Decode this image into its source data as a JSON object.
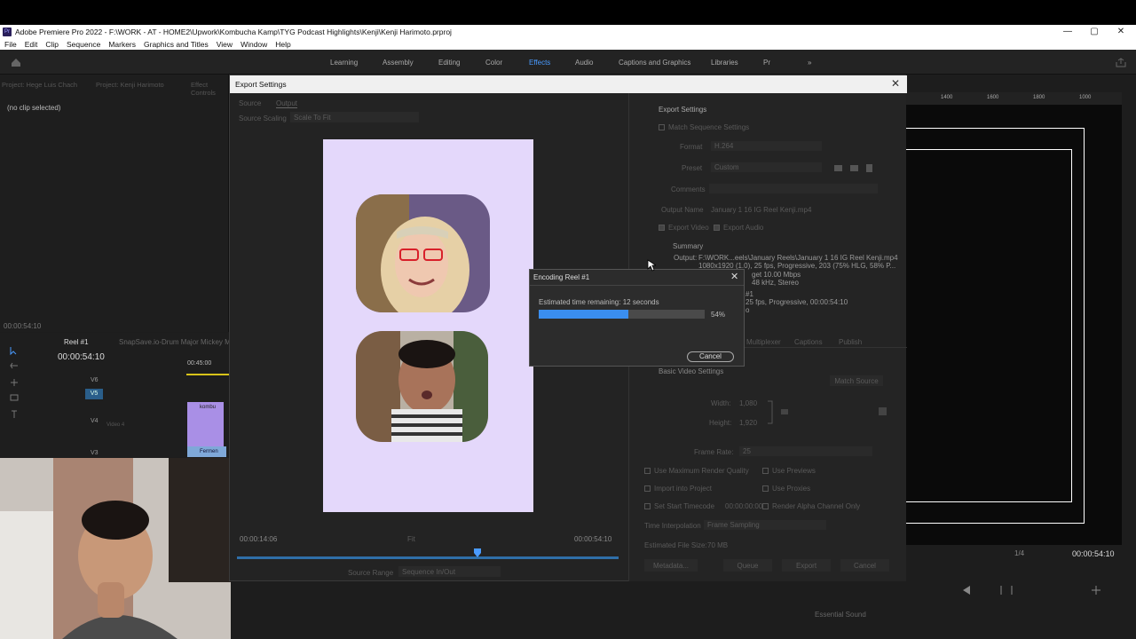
{
  "window": {
    "title": "Adobe Premiere Pro 2022 - F:\\WORK - AT - HOME2\\Upwork\\Kombucha Kamp\\TYG Podcast Highlights\\Kenji\\Kenji Harimoto.prproj",
    "app_icon": "Pr",
    "minimize": "—",
    "maximize": "▢",
    "close": "✕"
  },
  "menu": [
    "File",
    "Edit",
    "Clip",
    "Sequence",
    "Markers",
    "Graphics and Titles",
    "View",
    "Window",
    "Help"
  ],
  "workspaces": {
    "items": [
      "Learning",
      "Assembly",
      "Editing",
      "Color",
      "Effects",
      "Audio",
      "Captions and Graphics",
      "Libraries",
      "Pr"
    ],
    "active": "Effects",
    "more": "»"
  },
  "left_panel": {
    "tabs": [
      "Project: Hege Luis Chach",
      "Project: Kenji Harimoto",
      "Effect Controls"
    ],
    "no_clip": "(no clip selected)",
    "timecode_bottom": "00:00:54:10"
  },
  "timeline": {
    "tab": "Reel #1",
    "tab2": "SnapSave.io-Drum Major Mickey Mo",
    "timecode": "00:00:54:10",
    "ruler_time": "00:45:00",
    "tracks": [
      {
        "name": "V6"
      },
      {
        "name": "V5"
      },
      {
        "name": "V4",
        "sub": "Video 4"
      },
      {
        "name": "V3"
      }
    ],
    "clips": [
      "kombu",
      "Fermen"
    ]
  },
  "right_panel": {
    "ruler_ticks": [
      "1400",
      "1600",
      "1800",
      "1000"
    ],
    "timecode": "00:00:54:10",
    "zoom": "1/4",
    "essential_sound": "Essential Sound"
  },
  "export_dialog": {
    "title": "Export Settings",
    "tabs": [
      "Source",
      "Output"
    ],
    "source_scaling_label": "Source Scaling",
    "source_scaling_value": "Scale To Fit",
    "timecode_left": "00:00:14:06",
    "timecode_right": "00:00:54:10",
    "fit": "Fit",
    "source_range_label": "Source Range",
    "source_range_value": "Sequence In/Out",
    "settings": {
      "heading": "Export Settings",
      "match_sequence": "Match Sequence Settings",
      "format_label": "Format",
      "format_value": "H.264",
      "preset_label": "Preset",
      "preset_value": "Custom",
      "comments_label": "Comments",
      "output_name_label": "Output Name",
      "output_name_value": "January 1 16 IG Reel Kenji.mp4",
      "export_video": "Export Video",
      "export_audio": "Export Audio",
      "summary_heading": "Summary",
      "output_label": "Output:",
      "output_lines": [
        "F:\\WORK...eels\\January Reels\\January 1 16 IG Reel Kenji.mp4",
        "1080x1920 (1.0), 25 fps, Progressive, 203 (75% HLG, 58% P...",
        "get 10.00 Mbps",
        "48 kHz, Stereo"
      ],
      "source_lines": [
        "#1",
        "25 fps, Progressive, 00:00:54:10",
        "o"
      ]
    },
    "lower_tabs": [
      "Multiplexer",
      "Captions",
      "Publish"
    ],
    "video_settings": {
      "heading": "Basic Video Settings",
      "match_source": "Match Source",
      "width_label": "Width:",
      "width_value": "1,080",
      "height_label": "Height:",
      "height_value": "1,920",
      "frame_rate_label": "Frame Rate:",
      "frame_rate_value": "25"
    },
    "options": {
      "max_render": "Use Maximum Render Quality",
      "use_previews": "Use Previews",
      "import_project": "Import into Project",
      "use_proxies": "Use Proxies",
      "start_timecode": "Set Start Timecode",
      "start_timecode_value": "00:00:00:00",
      "render_alpha": "Render Alpha Channel Only",
      "time_interp_label": "Time Interpolation",
      "time_interp_value": "Frame Sampling",
      "file_size": "Estimated File Size:",
      "file_size_value": "70 MB"
    },
    "buttons": [
      "Metadata...",
      "Queue",
      "Export",
      "Cancel"
    ]
  },
  "encoding": {
    "title": "Encoding Reel #1",
    "remaining": "Estimated time remaining: 12 seconds",
    "percent_text": "54%",
    "progress": 0.54,
    "cancel": "Cancel"
  },
  "colors": {
    "accent": "#3a8ef0",
    "preview_bg": "#e4d8fb",
    "clip_purple": "#a98fe6"
  }
}
